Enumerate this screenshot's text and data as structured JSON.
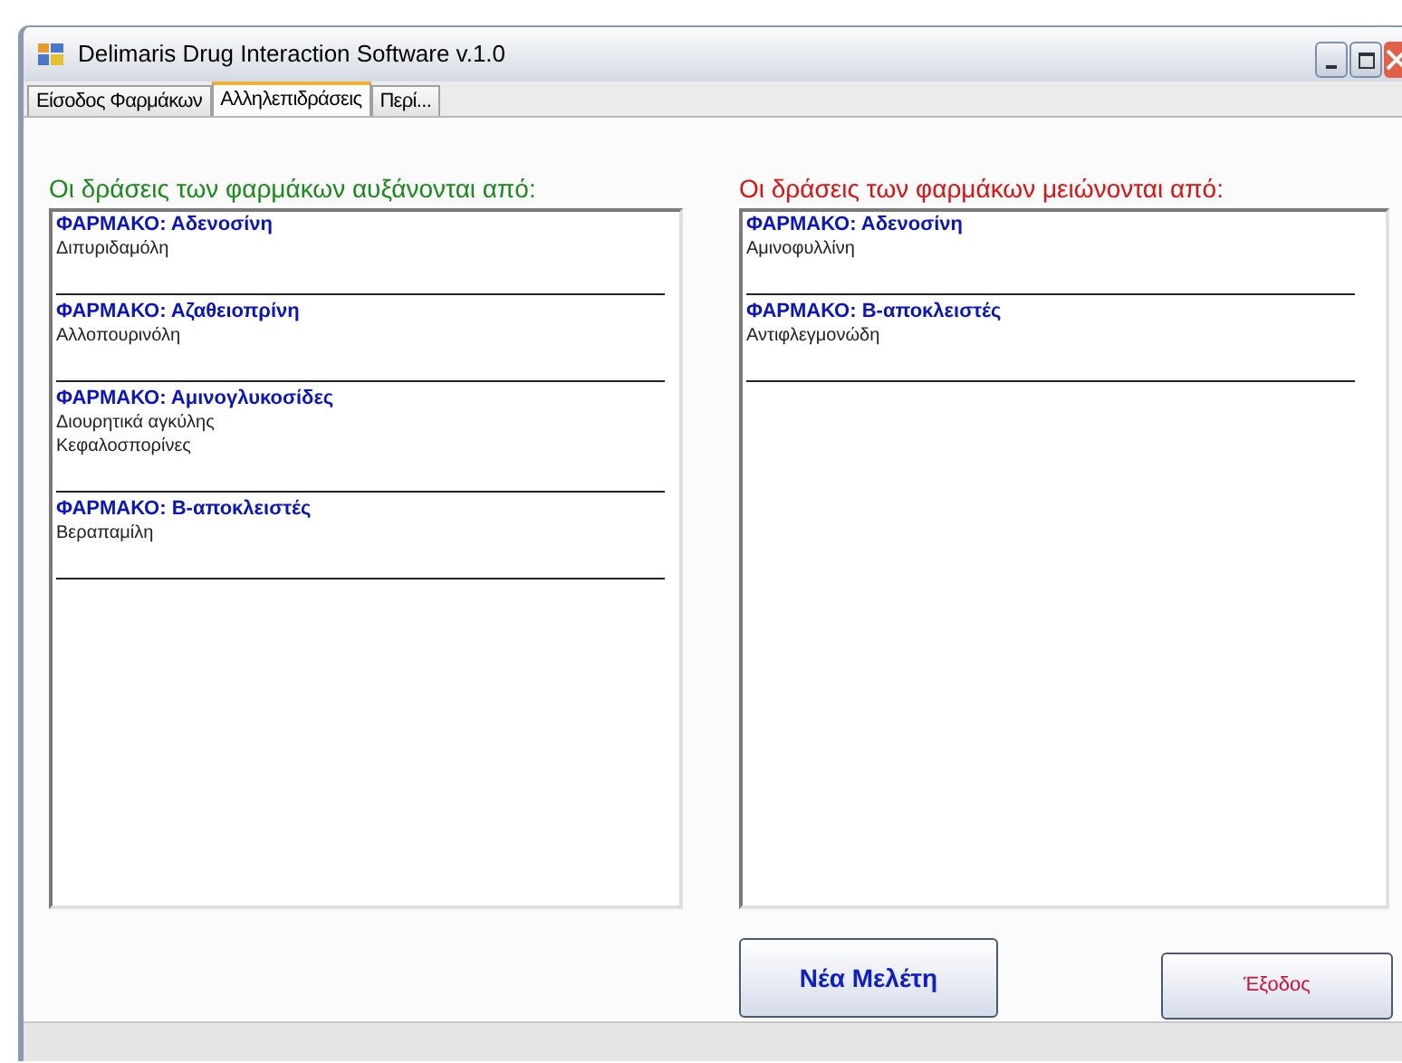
{
  "window": {
    "title": "Delimaris Drug Interaction Software v.1.0"
  },
  "tabs": [
    {
      "label": "Είσοδος Φαρμάκων",
      "selected": false
    },
    {
      "label": "Αλληλεπιδράσεις",
      "selected": true
    },
    {
      "label": "Περί...",
      "selected": false
    }
  ],
  "panels": [
    {
      "heading": "Οι δράσεις των φαρμάκων αυξάνονται από:",
      "color": "#1a8a1a",
      "entries": [
        {
          "drug": "ΦΑΡΜΑΚΟ: Αδενοσίνη",
          "items": [
            "Διπυριδαμόλη"
          ]
        },
        {
          "drug": "ΦΑΡΜΑΚΟ: Αζαθειοπρίνη",
          "items": [
            "Αλλοπουρινόλη"
          ]
        },
        {
          "drug": "ΦΑΡΜΑΚΟ: Αμινογλυκοσίδες",
          "items": [
            "Διουρητικά αγκύλης",
            "Κεφαλοσπορίνες"
          ]
        },
        {
          "drug": "ΦΑΡΜΑΚΟ: Β-αποκλειστές",
          "items": [
            "Βεραπαμίλη"
          ]
        }
      ]
    },
    {
      "heading": "Οι δράσεις των φαρμάκων μειώνονται από:",
      "color": "#e01010",
      "entries": [
        {
          "drug": "ΦΑΡΜΑΚΟ: Αδενοσίνη",
          "items": [
            "Αμινοφυλλίνη"
          ]
        },
        {
          "drug": "ΦΑΡΜΑΚΟ: Β-αποκλειστές",
          "items": [
            "Αντιφλεγμονώδη"
          ]
        }
      ]
    }
  ],
  "buttons": [
    {
      "label": "Νέα Μελέτη"
    },
    {
      "label": "Έξοδος"
    }
  ]
}
